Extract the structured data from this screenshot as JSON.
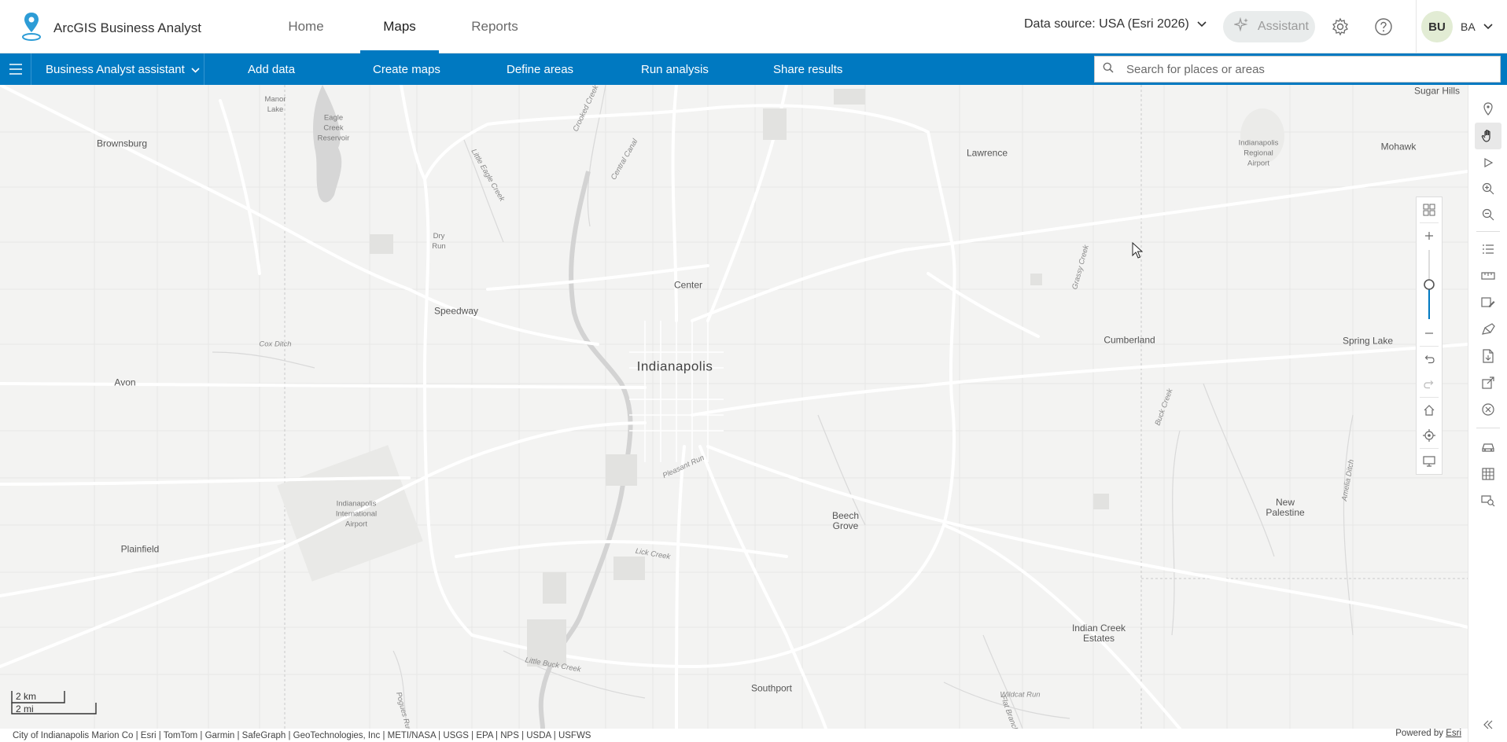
{
  "header": {
    "app_title": "ArcGIS Business Analyst",
    "tabs": [
      {
        "label": "Home"
      },
      {
        "label": "Maps"
      },
      {
        "label": "Reports"
      }
    ],
    "active_tab": "Maps",
    "data_source": "Data source: USA (Esri 2026)",
    "assistant_label": "Assistant",
    "user": {
      "avatar_initials": "BU",
      "initials": "BA"
    }
  },
  "actionbar": {
    "assistant_dropdown": "Business Analyst assistant",
    "items": [
      {
        "label": "Add data"
      },
      {
        "label": "Create maps"
      },
      {
        "label": "Define areas"
      },
      {
        "label": "Run analysis"
      },
      {
        "label": "Share results"
      }
    ],
    "search_placeholder": "Search for places or areas"
  },
  "map": {
    "places": [
      {
        "name": "Indianapolis"
      },
      {
        "name": "Brownsburg"
      },
      {
        "name": "Lawrence"
      },
      {
        "name": "Speedway"
      },
      {
        "name": "Center"
      },
      {
        "name": "Avon"
      },
      {
        "name": "Cumberland"
      },
      {
        "name": "Spring Lake"
      },
      {
        "name": "Plainfield"
      },
      {
        "name": "Beech\nGrove"
      },
      {
        "name": "New\nPalestine"
      },
      {
        "name": "Indian Creek\nEstates"
      },
      {
        "name": "Southport"
      },
      {
        "name": "Sugar Hills"
      },
      {
        "name": "Mohawk"
      }
    ],
    "small_labels": [
      {
        "name": "Manor\nLake"
      },
      {
        "name": "Eagle\nCreek\nReservoir"
      },
      {
        "name": "Dry\nRun"
      },
      {
        "name": "Indianapolis\nRegional\nAirport"
      },
      {
        "name": "Indianapolis\nInternational\nAirport"
      }
    ],
    "water_labels": [
      {
        "name": "Little Eagle Creek"
      },
      {
        "name": "Central Canal"
      },
      {
        "name": "Crooked Creek"
      },
      {
        "name": "Cox Ditch"
      },
      {
        "name": "Pleasant Run"
      },
      {
        "name": "Lick Creek"
      },
      {
        "name": "Little Buck Creek"
      },
      {
        "name": "Grassy Creek"
      },
      {
        "name": "Buck Creek"
      },
      {
        "name": "Wildcat Run"
      },
      {
        "name": "Flat Branch"
      },
      {
        "name": "Amelia Ditch"
      },
      {
        "name": "Pogues Run"
      }
    ],
    "scale": {
      "km": "2 km",
      "mi": "2 mi"
    },
    "attribution": "City of Indianapolis Marion Co | Esri | TomTom | Garmin | SafeGraph | GeoTechnologies, Inc | METI/NASA | USGS | EPA | NPS | USDA | USFWS",
    "powered_by": "Powered by",
    "powered_link": "Esri"
  },
  "right_toolbar": {
    "tools": [
      "pin-icon",
      "pan-hand-icon",
      "select-arrow-icon",
      "zoom-in-icon",
      "zoom-out-icon",
      "layer-list-icon",
      "measure-icon",
      "map-edit-icon",
      "sketch-icon",
      "export-icon",
      "share-icon",
      "clear-icon",
      "drive-time-icon",
      "table-icon",
      "identify-icon",
      "collapse-icon"
    ],
    "active_tool": "pan-hand-icon"
  },
  "colors": {
    "brand_blue": "#0079c1",
    "map_background": "#f3f3f2",
    "road": "#ffffff",
    "water_fill": "#d6d6d6"
  }
}
